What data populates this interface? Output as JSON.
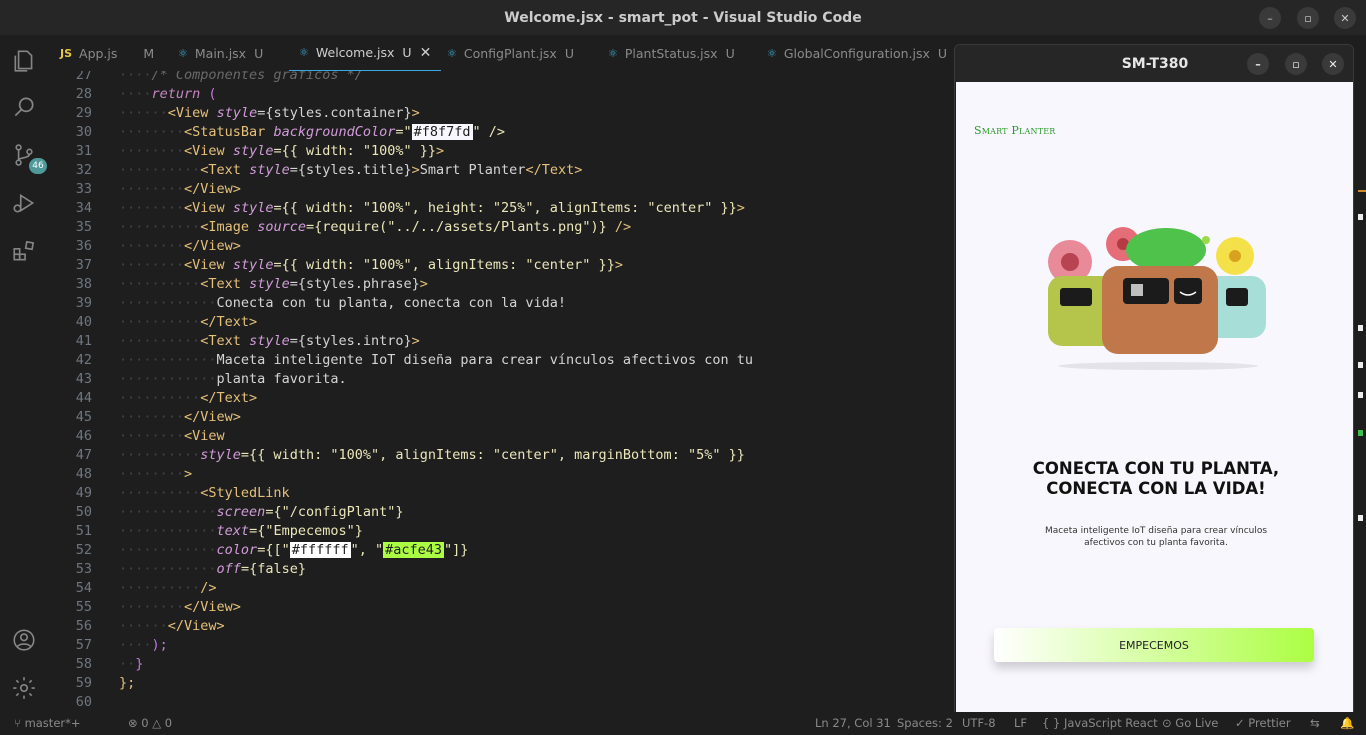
{
  "window": {
    "title": "Welcome.jsx - smart_pot - Visual Studio Code"
  },
  "activity": {
    "scm_badge": "46"
  },
  "tabs": [
    {
      "label": "App.js",
      "status": "M",
      "icon": "js-icon"
    },
    {
      "label": "Main.jsx",
      "status": "U",
      "icon": "react-icon"
    },
    {
      "label": "Welcome.jsx",
      "status": "U",
      "icon": "react-icon",
      "active": true
    },
    {
      "label": "ConfigPlant.jsx",
      "status": "U",
      "icon": "react-icon"
    },
    {
      "label": "PlantStatus.jsx",
      "status": "U",
      "icon": "react-icon"
    },
    {
      "label": "GlobalConfiguration.jsx",
      "status": "U",
      "icon": "react-icon"
    }
  ],
  "tab_js_icon_text": "JS",
  "tab_close_glyph": "✕",
  "code": {
    "n27": "27",
    "n28": "28",
    "n29": "29",
    "n30": "30",
    "n31": "31",
    "n32": "32",
    "n33": "33",
    "n34": "34",
    "n35": "35",
    "n36": "36",
    "n37": "37",
    "n38": "38",
    "n39": "39",
    "n40": "40",
    "n41": "41",
    "n42": "42",
    "n43": "43",
    "n44": "44",
    "n45": "45",
    "n46": "46",
    "n47": "47",
    "n48": "48",
    "n49": "49",
    "n50": "50",
    "n51": "51",
    "n52": "52",
    "n53": "53",
    "n54": "54",
    "n55": "55",
    "n56": "56",
    "n57": "57",
    "n58": "58",
    "n59": "59",
    "n60": "60",
    "l27": "/* Componentes gráficos */",
    "l28_kw": "return",
    "l28_p": " (",
    "l29_tag": "<View",
    "l29_attr": "style",
    "l29_val": "={styles.container}",
    "l29_end": ">",
    "l30_tag": "<StatusBar",
    "l30_attr": "backgroundColor",
    "l30_eq": "=\"",
    "l30_color": "#f8f7fd",
    "l30_end": "\" />",
    "l31_tag": "<View",
    "l31_attr": "style",
    "l31_val": "={{ width: \"100%\" }}",
    "l31_end": ">",
    "l32_tag": "<Text",
    "l32_attr": "style",
    "l32_val": "={styles.title}",
    "l32_gt": ">",
    "l32_text": "Smart Planter",
    "l32_close": "</Text>",
    "l33": "</View>",
    "l34_tag": "<View",
    "l34_attr": "style",
    "l34_val": "={{ width: \"100%\", height: \"25%\", alignItems: \"center\" }}",
    "l34_end": ">",
    "l35_tag": "<Image",
    "l35_attr": "source",
    "l35_val": "={require(\"../../assets/Plants.png\")}",
    "l35_end": " />",
    "l36": "</View>",
    "l37_tag": "<View",
    "l37_attr": "style",
    "l37_val": "={{ width: \"100%\", alignItems: \"center\" }}",
    "l37_end": ">",
    "l38_tag": "<Text",
    "l38_attr": "style",
    "l38_val": "={styles.phrase}",
    "l38_end": ">",
    "l39": "Conecta con tu planta, conecta con la vida!",
    "l40": "</Text>",
    "l41_tag": "<Text",
    "l41_attr": "style",
    "l41_val": "={styles.intro}",
    "l41_end": ">",
    "l42": "Maceta inteligente IoT diseña para crear vínculos afectivos con tu",
    "l43": "planta favorita.",
    "l44": "</Text>",
    "l45": "</View>",
    "l46": "<View",
    "l47_attr": "style",
    "l47_val": "={{ width: \"100%\", alignItems: \"center\", marginBottom: \"5%\" }}",
    "l48": ">",
    "l49": "<StyledLink",
    "l50_attr": "screen",
    "l50_val": "={\"/configPlant\"}",
    "l51_attr": "text",
    "l51_val": "={\"Empecemos\"}",
    "l52_attr": "color",
    "l52_a": "={[\"",
    "l52_c1": "#ffffff",
    "l52_b": "\", \"",
    "l52_c2": "#acfe43",
    "l52_end": "\"]}",
    "l53_attr": "off",
    "l53_val": "={false}",
    "l54": "/>",
    "l55": "</View>",
    "l56": "</View>",
    "l57": ");",
    "l58": "}",
    "l59": "};"
  },
  "statusbar": {
    "branch": "master*+",
    "problems": "⊗ 0 △ 0",
    "position": "Ln 27, Col 31",
    "spaces": "Spaces: 2",
    "encoding": "UTF-8",
    "eol": "LF",
    "language": "{ } JavaScript React",
    "golive": "⊙ Go Live",
    "prettier": "✓ Prettier"
  },
  "emulator": {
    "device_title": "SM-T380",
    "app_title": "Smart Planter",
    "phrase": "Conecta con tu planta, conecta con la vida!",
    "intro": "Maceta inteligente IoT diseña para crear vínculos afectivos con tu planta favorita.",
    "cta_label": "Empecemos",
    "cta_colors": [
      "#ffffff",
      "#acfe43"
    ],
    "background": "#f8f7fd"
  },
  "colors": {
    "accent": "#3ba7e0",
    "badge": "#4e9a9a"
  }
}
